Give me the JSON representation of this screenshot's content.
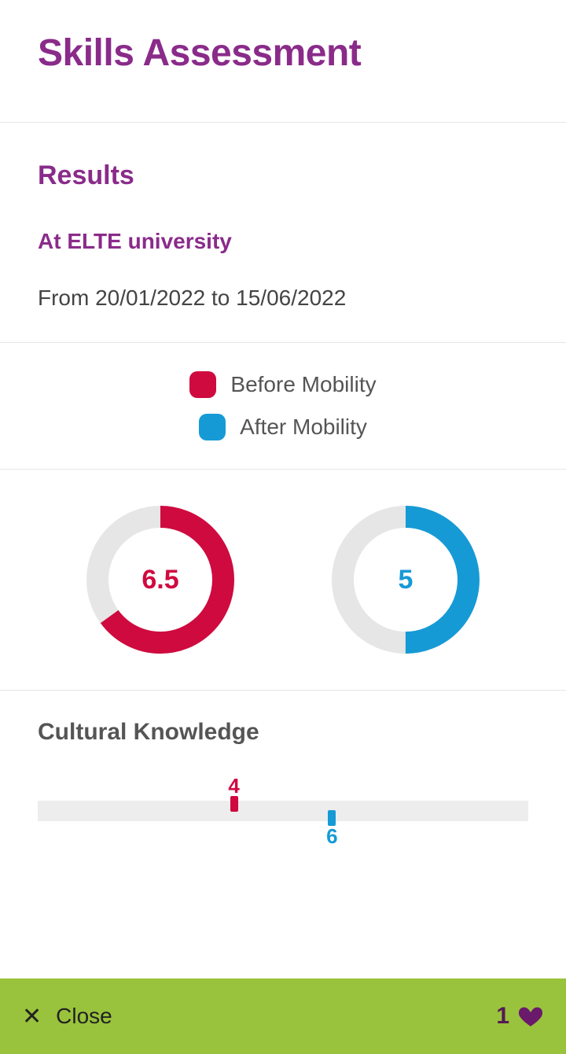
{
  "header": {
    "title": "Skills Assessment"
  },
  "results": {
    "heading": "Results",
    "location_label": "At ELTE university",
    "date_range": "From 20/01/2022 to 15/06/2022"
  },
  "legend": {
    "before_label": "Before Mobility",
    "after_label": "After Mobility",
    "before_color": "#cf0a3f",
    "after_color": "#169ad6"
  },
  "donuts": {
    "max": 10,
    "before": {
      "value": 6.5,
      "display": "6.5"
    },
    "after": {
      "value": 5,
      "display": "5"
    }
  },
  "skill": {
    "name": "Cultural Knowledge",
    "scale_max": 10,
    "before": {
      "value": 4,
      "display": "4"
    },
    "after": {
      "value": 6,
      "display": "6"
    }
  },
  "footer": {
    "close_label": "Close",
    "likes": "1"
  },
  "chart_data": [
    {
      "type": "pie",
      "title": "Before Mobility overall score",
      "series": [
        {
          "name": "Before Mobility",
          "values": [
            6.5
          ]
        }
      ],
      "value": 6.5,
      "max": 10,
      "color": "#cf0a3f"
    },
    {
      "type": "pie",
      "title": "After Mobility overall score",
      "series": [
        {
          "name": "After Mobility",
          "values": [
            5
          ]
        }
      ],
      "value": 5,
      "max": 10,
      "color": "#169ad6"
    },
    {
      "type": "bar",
      "title": "Cultural Knowledge",
      "categories": [
        "Cultural Knowledge"
      ],
      "series": [
        {
          "name": "Before Mobility",
          "values": [
            4
          ]
        },
        {
          "name": "After Mobility",
          "values": [
            6
          ]
        }
      ],
      "xlabel": "",
      "ylabel": "",
      "ylim": [
        0,
        10
      ]
    }
  ]
}
